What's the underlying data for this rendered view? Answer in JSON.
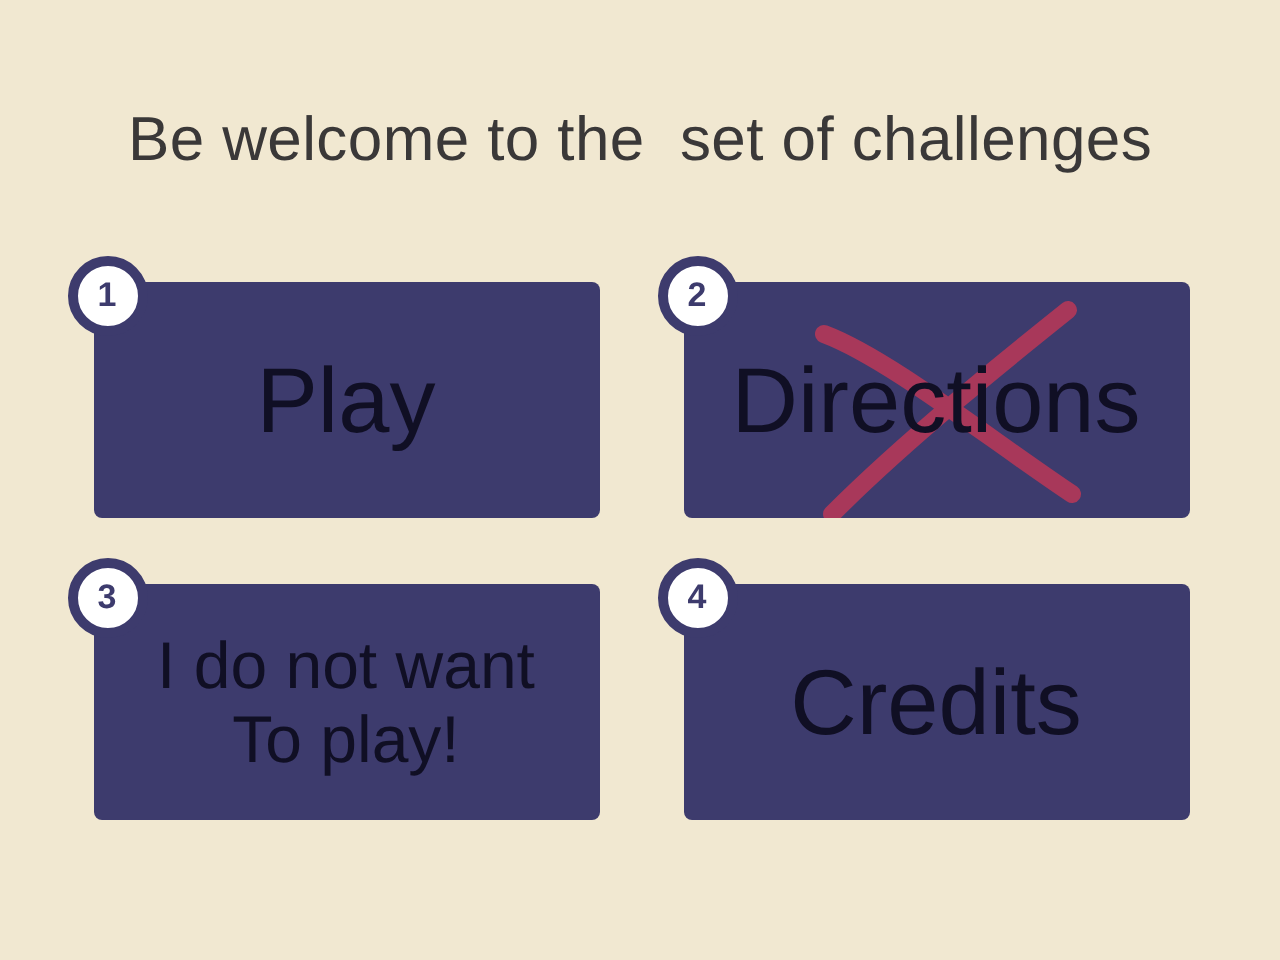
{
  "title": "Be welcome to the  set of challenges",
  "buttons": [
    {
      "number": "1",
      "lines": [
        "Play"
      ],
      "crossed": false
    },
    {
      "number": "2",
      "lines": [
        "Directions"
      ],
      "crossed": true
    },
    {
      "number": "3",
      "lines": [
        "I do not want",
        "To play!"
      ],
      "crossed": false
    },
    {
      "number": "4",
      "lines": [
        "Credits"
      ],
      "crossed": false
    }
  ]
}
